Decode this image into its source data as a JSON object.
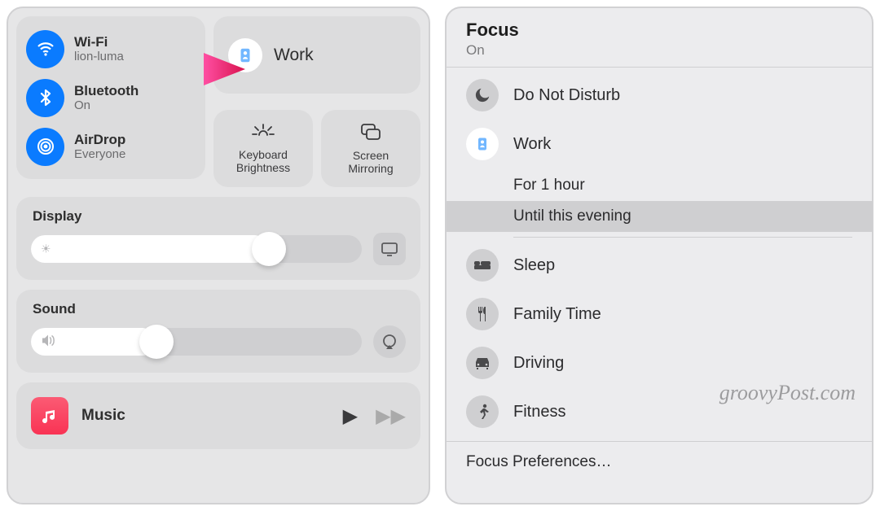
{
  "control_center": {
    "wifi": {
      "title": "Wi-Fi",
      "sub": "lion-luma"
    },
    "bluetooth": {
      "title": "Bluetooth",
      "sub": "On"
    },
    "airdrop": {
      "title": "AirDrop",
      "sub": "Everyone"
    },
    "focus_button": {
      "label": "Work"
    },
    "keyboard_brightness": {
      "label": "Keyboard\nBrightness"
    },
    "screen_mirroring": {
      "label": "Screen\nMirroring"
    },
    "display": {
      "label": "Display",
      "value_pct": 72
    },
    "sound": {
      "label": "Sound",
      "value_pct": 38
    },
    "music": {
      "label": "Music"
    }
  },
  "focus_panel": {
    "title": "Focus",
    "status": "On",
    "items": {
      "dnd": "Do Not Disturb",
      "work": "Work",
      "sleep": "Sleep",
      "family": "Family Time",
      "driving": "Driving",
      "fitness": "Fitness"
    },
    "work_sub": {
      "opt1": "For 1 hour",
      "opt2": "Until this evening"
    },
    "preferences": "Focus Preferences…"
  },
  "watermark": "groovyPost.com"
}
